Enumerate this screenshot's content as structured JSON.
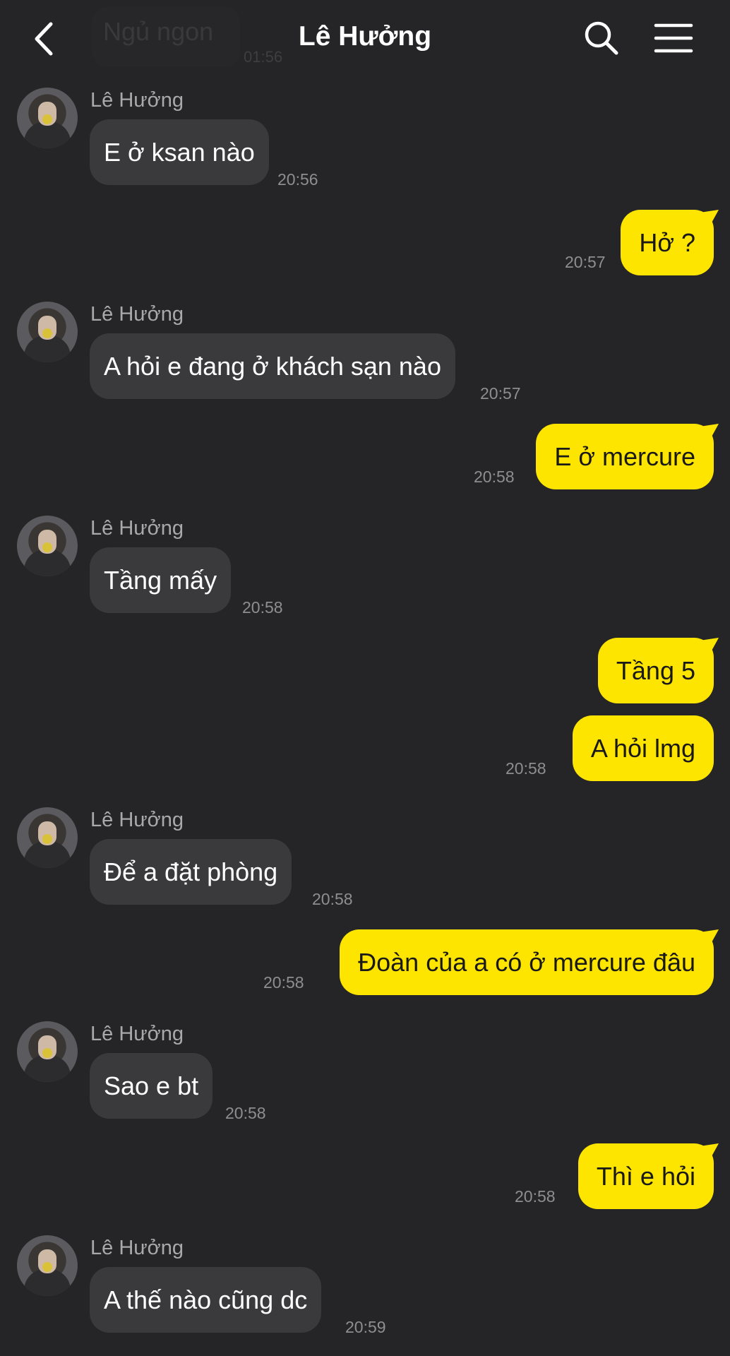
{
  "header": {
    "title": "Lê Hưởng",
    "ghost_message": "Ngủ ngon",
    "ghost_time": "01:56",
    "icons": [
      "back-icon",
      "search-icon",
      "menu-icon"
    ]
  },
  "colors": {
    "background": "#252527",
    "incoming_bubble": "#3a3a3d",
    "outgoing_bubble": "#fee500",
    "outgoing_text": "#191919",
    "timestamp": "#8e8e92"
  },
  "messages": [
    {
      "sender": "Lê Hưởng",
      "text": "E ở ksan nào",
      "time": "20:56"
    },
    {
      "text": "Hở ?",
      "time": "20:57"
    },
    {
      "sender": "Lê Hưởng",
      "text": "A hỏi e đang ở khách sạn nào",
      "time": "20:57"
    },
    {
      "text": "E ở mercure",
      "time": "20:58"
    },
    {
      "sender": "Lê Hưởng",
      "text": "Tầng mấy",
      "time": "20:58"
    },
    {
      "text": "Tầng 5"
    },
    {
      "text": "A hỏi lmg",
      "time": "20:58"
    },
    {
      "sender": "Lê Hưởng",
      "text": "Để a đặt phòng",
      "time": "20:58"
    },
    {
      "text": "Đoàn của a có ở mercure đâu",
      "time": "20:58"
    },
    {
      "sender": "Lê Hưởng",
      "text": "Sao e bt",
      "time": "20:58"
    },
    {
      "text": "Thì e hỏi",
      "time": "20:58"
    },
    {
      "sender": "Lê Hưởng",
      "text": "A thế nào cũng dc",
      "time": "20:59"
    }
  ]
}
